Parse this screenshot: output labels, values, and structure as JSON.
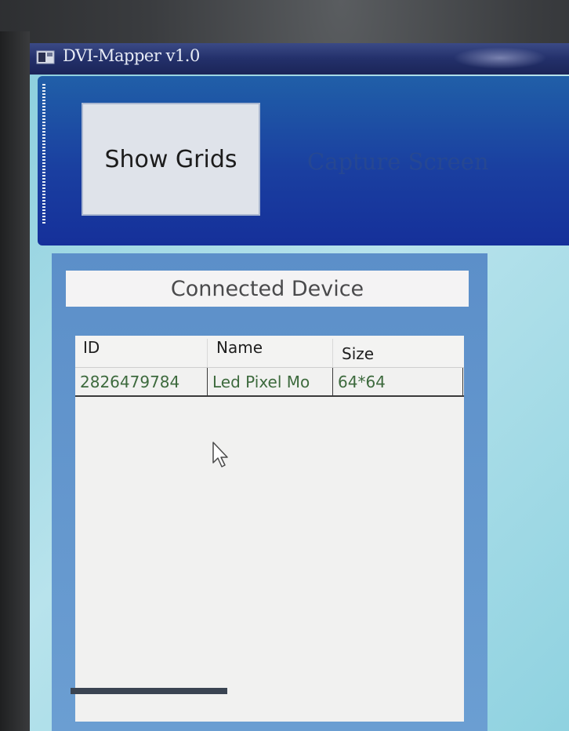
{
  "window": {
    "title": "DVI-Mapper v1.0",
    "icon": "app-window-icon"
  },
  "toolbar": {
    "show_grids_label": "Show Grids",
    "capture_screen_label": "Capture Screen"
  },
  "device_panel": {
    "header": "Connected Device",
    "columns": [
      "ID",
      "Name",
      "Size"
    ],
    "rows": [
      {
        "id": "2826479784",
        "name": "Led Pixel Mo",
        "size": "64*64"
      }
    ]
  },
  "colors": {
    "titlebar": "#23306a",
    "toolbar": "#1a3fa0",
    "client_bg": "#b8e3ec",
    "panel": "#6b9ed2",
    "cell_text": "#3d6a3d"
  }
}
